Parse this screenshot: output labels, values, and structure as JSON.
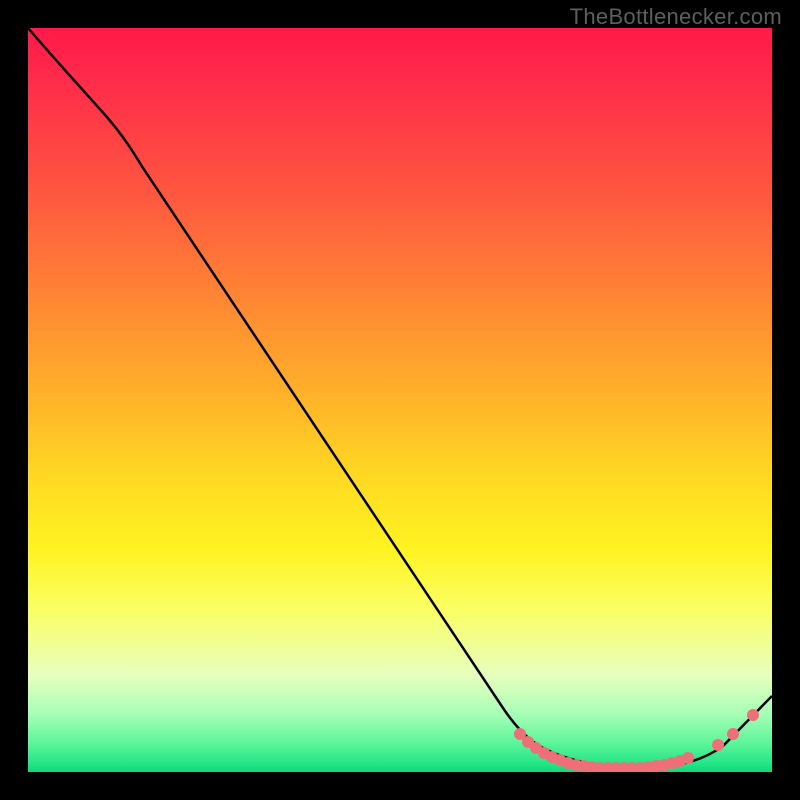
{
  "watermark": "TheBottlenecker.com",
  "chart_data": {
    "type": "line",
    "title": "",
    "xlabel": "",
    "ylabel": "",
    "xlim": [
      0,
      100
    ],
    "ylim": [
      0,
      100
    ],
    "series": [
      {
        "name": "bottleneck-curve",
        "x": [
          0,
          7,
          12,
          20,
          30,
          40,
          50,
          58,
          64,
          68,
          72,
          76,
          80,
          84,
          88,
          92,
          97,
          100
        ],
        "y": [
          100,
          93,
          87,
          76,
          63,
          49,
          36,
          25,
          16,
          10,
          6,
          3,
          1,
          0,
          0,
          1,
          5,
          8
        ]
      }
    ],
    "markers": {
      "cluster_start_x": 66,
      "cluster_end_x": 88,
      "cluster_y": 0.5,
      "tail_points_x": [
        91,
        94,
        97
      ],
      "tail_points_y": [
        2,
        4,
        6
      ]
    },
    "colors": {
      "curve": "#000000",
      "marker": "#ef6f78",
      "gradient_top": "#ff1a4a",
      "gradient_mid": "#ffe522",
      "gradient_bottom": "#18d47a"
    }
  }
}
